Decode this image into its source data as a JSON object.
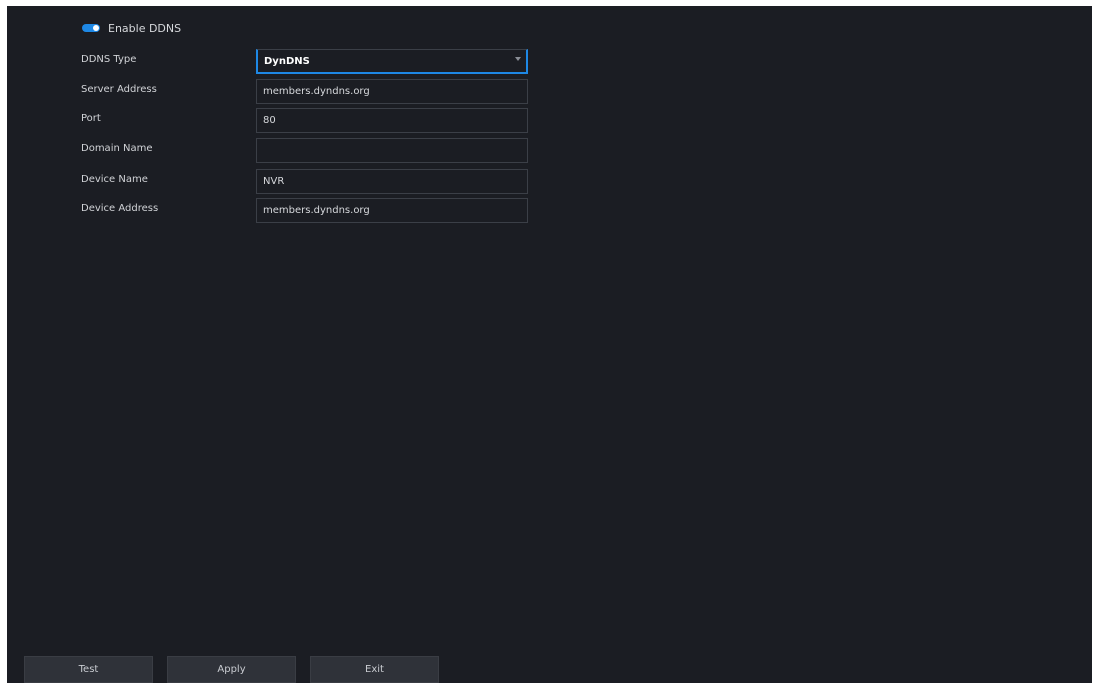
{
  "toggle": {
    "label": "Enable DDNS",
    "enabled": true,
    "accent": "#1e88e5"
  },
  "form": {
    "rows": [
      {
        "label": "DDNS Type",
        "value": "DynDNS",
        "kind": "select"
      },
      {
        "label": "Server Address",
        "value": "members.dyndns.org",
        "kind": "input"
      },
      {
        "label": "Port",
        "value": "80",
        "kind": "input"
      },
      {
        "label": "Domain Name",
        "value": "",
        "kind": "input"
      },
      {
        "label": "Device Name",
        "value": "NVR",
        "kind": "input"
      },
      {
        "label": "Device Address",
        "value": "members.dyndns.org",
        "kind": "input"
      }
    ]
  },
  "buttons": {
    "test": "Test",
    "apply": "Apply",
    "exit": "Exit"
  }
}
